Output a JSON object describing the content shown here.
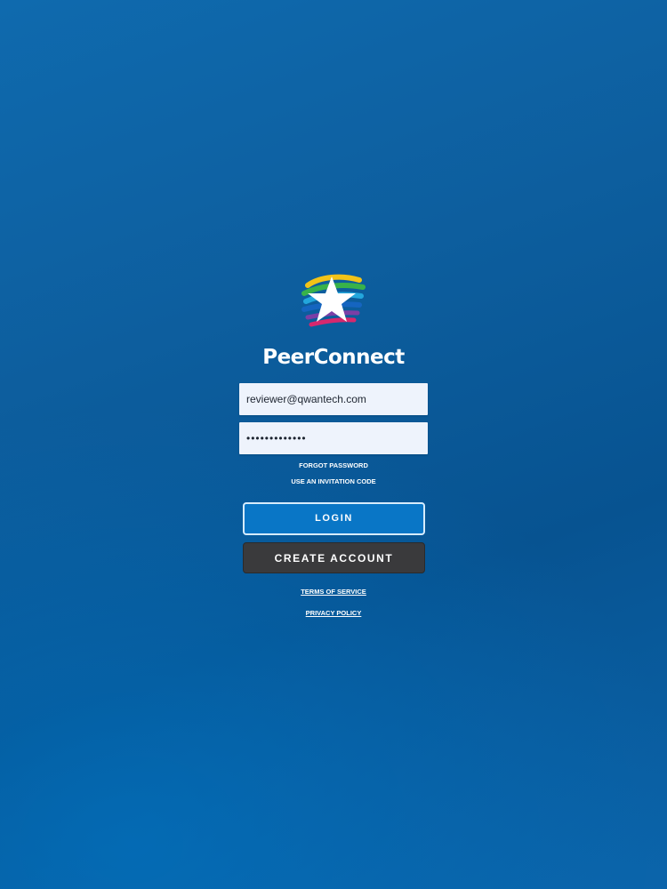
{
  "app": {
    "name": "PeerConnect"
  },
  "login_form": {
    "email_value": "reviewer@qwantech.com",
    "password_value": "•••••••••••••",
    "forgot_password_label": "FORGOT PASSWORD",
    "invitation_code_label": "USE AN INVITATION CODE",
    "login_button_label": "LOGIN",
    "create_account_button_label": "CREATE ACCOUNT"
  },
  "footer": {
    "terms_label": "TERMS OF SERVICE",
    "privacy_label": "PRIVACY POLICY"
  },
  "icons": {
    "logo": "star-brush-logo-icon"
  },
  "colors": {
    "background": "#0b5fa3",
    "login_button": "#0976c6",
    "create_account_button": "#3a3a3c",
    "field_background": "#eef3fc"
  }
}
